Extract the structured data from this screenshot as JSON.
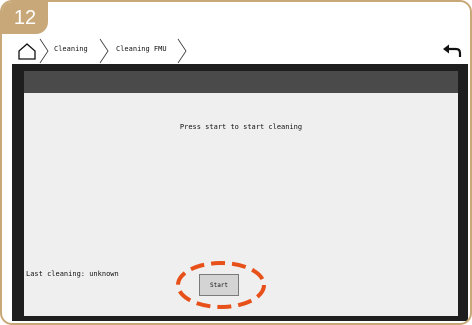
{
  "step": {
    "number": "12"
  },
  "breadcrumb": {
    "items": [
      {
        "label": "Cleaning"
      },
      {
        "label": "Cleaning FMU"
      }
    ]
  },
  "icons": {
    "home": "home-icon",
    "back": "back-arrow-icon",
    "separator": "chevron-right-icon"
  },
  "main": {
    "prompt": "Press start to start cleaning",
    "last_cleaning": "Last cleaning:  unknown",
    "start_label": "Start"
  },
  "colors": {
    "frame_accent": "#c8a878",
    "highlight": "#e8501a",
    "screen_background": "#1e1e1e",
    "header_bar": "#4a4a4a",
    "content_background": "#efefef"
  }
}
